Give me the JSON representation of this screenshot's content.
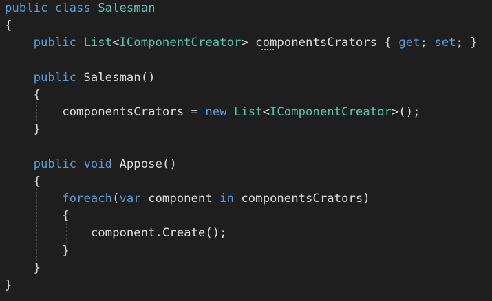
{
  "editor": {
    "lines": [
      [
        {
          "c": "kw",
          "t": "public"
        },
        {
          "c": "plain",
          "t": " "
        },
        {
          "c": "kw",
          "t": "class"
        },
        {
          "c": "plain",
          "t": " "
        },
        {
          "c": "type",
          "t": "Salesman"
        }
      ],
      [
        {
          "c": "plain",
          "t": "{"
        }
      ],
      [
        {
          "c": "plain",
          "t": "    "
        },
        {
          "c": "kw",
          "t": "public"
        },
        {
          "c": "plain",
          "t": " "
        },
        {
          "c": "type",
          "t": "List"
        },
        {
          "c": "plain",
          "t": "<"
        },
        {
          "c": "type",
          "t": "IComponentCreator"
        },
        {
          "c": "plain",
          "t": "> componentsCrators { "
        },
        {
          "c": "kw",
          "t": "get"
        },
        {
          "c": "plain",
          "t": "; "
        },
        {
          "c": "kw",
          "t": "set"
        },
        {
          "c": "plain",
          "t": "; }"
        }
      ],
      [
        {
          "c": "plain",
          "t": ""
        }
      ],
      [
        {
          "c": "plain",
          "t": "    "
        },
        {
          "c": "kw",
          "t": "public"
        },
        {
          "c": "plain",
          "t": " Salesman()"
        }
      ],
      [
        {
          "c": "plain",
          "t": "    {"
        }
      ],
      [
        {
          "c": "plain",
          "t": "        componentsCrators = "
        },
        {
          "c": "kw",
          "t": "new"
        },
        {
          "c": "plain",
          "t": " "
        },
        {
          "c": "type",
          "t": "List"
        },
        {
          "c": "plain",
          "t": "<"
        },
        {
          "c": "type",
          "t": "IComponentCreator"
        },
        {
          "c": "plain",
          "t": ">();"
        }
      ],
      [
        {
          "c": "plain",
          "t": "    }"
        }
      ],
      [
        {
          "c": "plain",
          "t": ""
        }
      ],
      [
        {
          "c": "plain",
          "t": "    "
        },
        {
          "c": "kw",
          "t": "public"
        },
        {
          "c": "plain",
          "t": " "
        },
        {
          "c": "kw",
          "t": "void"
        },
        {
          "c": "plain",
          "t": " Appose()"
        }
      ],
      [
        {
          "c": "plain",
          "t": "    {"
        }
      ],
      [
        {
          "c": "plain",
          "t": "        "
        },
        {
          "c": "kw",
          "t": "foreach"
        },
        {
          "c": "plain",
          "t": "("
        },
        {
          "c": "kw",
          "t": "var"
        },
        {
          "c": "plain",
          "t": " component "
        },
        {
          "c": "kw",
          "t": "in"
        },
        {
          "c": "plain",
          "t": " componentsCrators)"
        }
      ],
      [
        {
          "c": "plain",
          "t": "        {"
        }
      ],
      [
        {
          "c": "plain",
          "t": "            component.Create();"
        }
      ],
      [
        {
          "c": "plain",
          "t": "        }"
        }
      ],
      [
        {
          "c": "plain",
          "t": "    }"
        }
      ],
      [
        {
          "c": "plain",
          "t": "}"
        }
      ]
    ]
  },
  "colors": {
    "background": "#1e1e1e",
    "keyword": "#569cd6",
    "type": "#4ec9b0",
    "text": "#dcdcdc"
  }
}
